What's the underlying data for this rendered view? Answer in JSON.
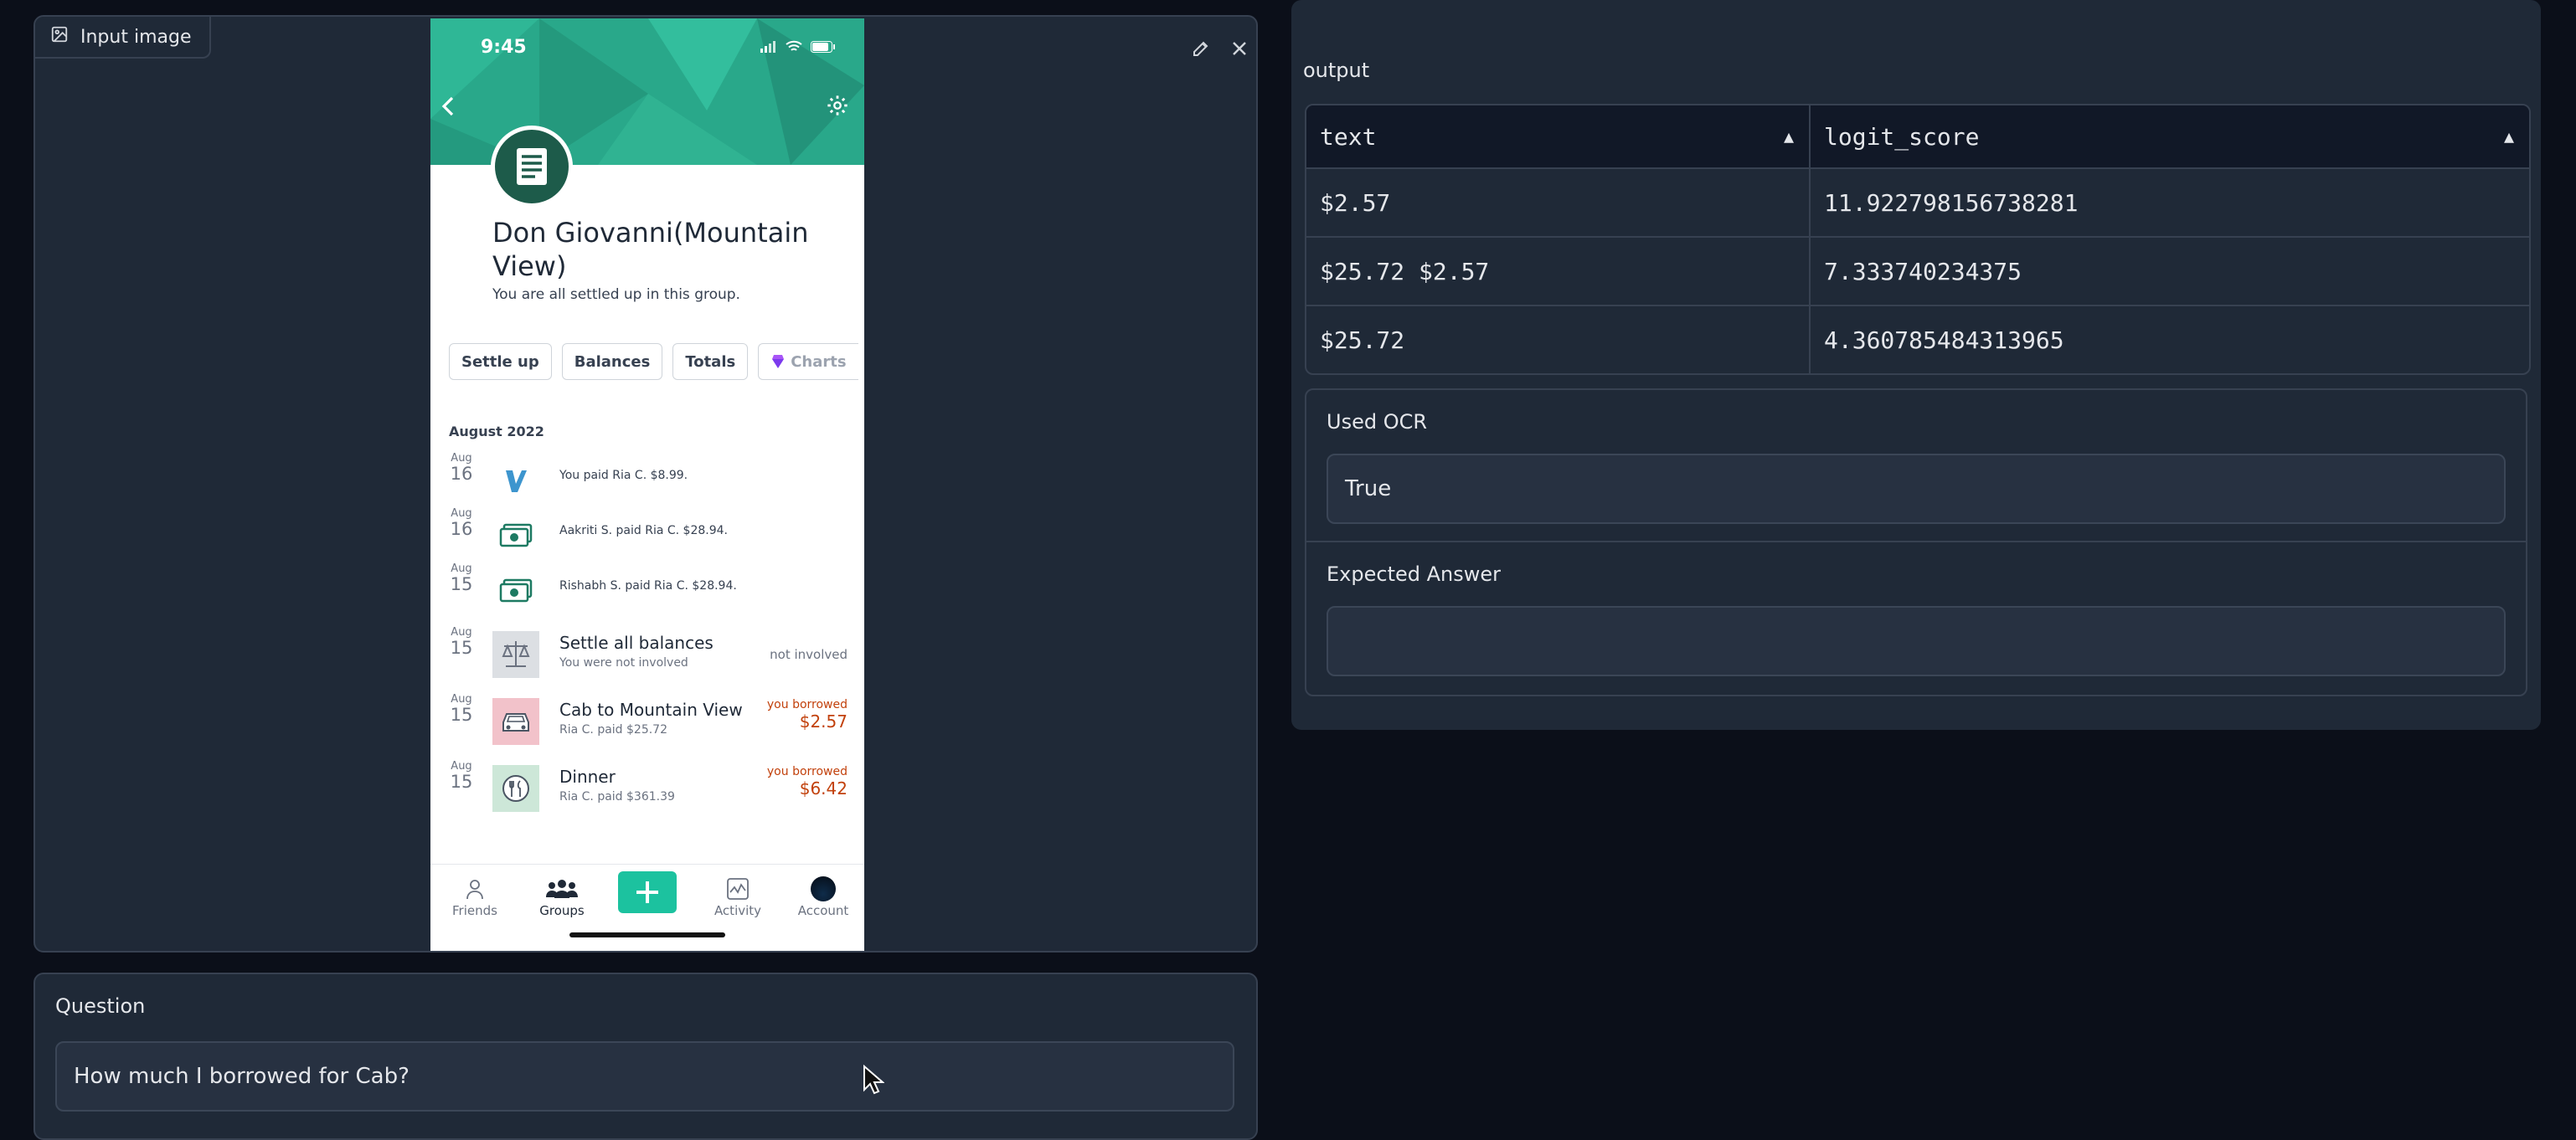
{
  "image_panel": {
    "label": "Input image"
  },
  "phone": {
    "status_time": "9:45",
    "group_title": "Don Giovanni(Mountain View)",
    "group_subtitle": "You are all settled up in this group.",
    "chips": [
      "Settle up",
      "Balances",
      "Totals",
      "Charts"
    ],
    "month": "August 2022",
    "rows": [
      {
        "month": "Aug",
        "day": "16",
        "icon": "venmo-icon",
        "text": "You paid Ria C. $8.99."
      },
      {
        "month": "Aug",
        "day": "16",
        "icon": "cash-icon",
        "text": "Aakriti S. paid Ria C. $28.94."
      },
      {
        "month": "Aug",
        "day": "15",
        "icon": "cash-icon",
        "text": "Rishabh S. paid Ria C. $28.94."
      },
      {
        "month": "Aug",
        "day": "15",
        "icon": "scale-icon",
        "title": "Settle all balances",
        "sub": "You were not involved",
        "right": "not involved"
      },
      {
        "month": "Aug",
        "day": "15",
        "icon": "car-icon",
        "title": "Cab to Mountain View",
        "sub": "Ria C. paid $25.72",
        "right_label": "you borrowed",
        "right_amount": "$2.57"
      },
      {
        "month": "Aug",
        "day": "15",
        "icon": "fork-knife-icon",
        "title": "Dinner",
        "sub": "Ria C. paid $361.39",
        "right_label": "you borrowed",
        "right_amount": "$6.42"
      }
    ],
    "tabs": [
      "Friends",
      "Groups",
      "Activity",
      "Account"
    ],
    "colors": {
      "header": "#29a88a",
      "accent": "#1cc29f",
      "borrowed": "#c2410c"
    }
  },
  "question": {
    "label": "Question",
    "value": "How much I borrowed for Cab?"
  },
  "output": {
    "label": "output",
    "headers": [
      "text",
      "logit_score"
    ],
    "rows": [
      [
        "$2.57",
        "11.922798156738281"
      ],
      [
        "$25.72 $2.57",
        "7.333740234375"
      ],
      [
        "$25.72",
        "4.360785484313965"
      ]
    ]
  },
  "used_ocr": {
    "label": "Used OCR",
    "value": "True"
  },
  "expected_answer": {
    "label": "Expected Answer",
    "value": ""
  }
}
